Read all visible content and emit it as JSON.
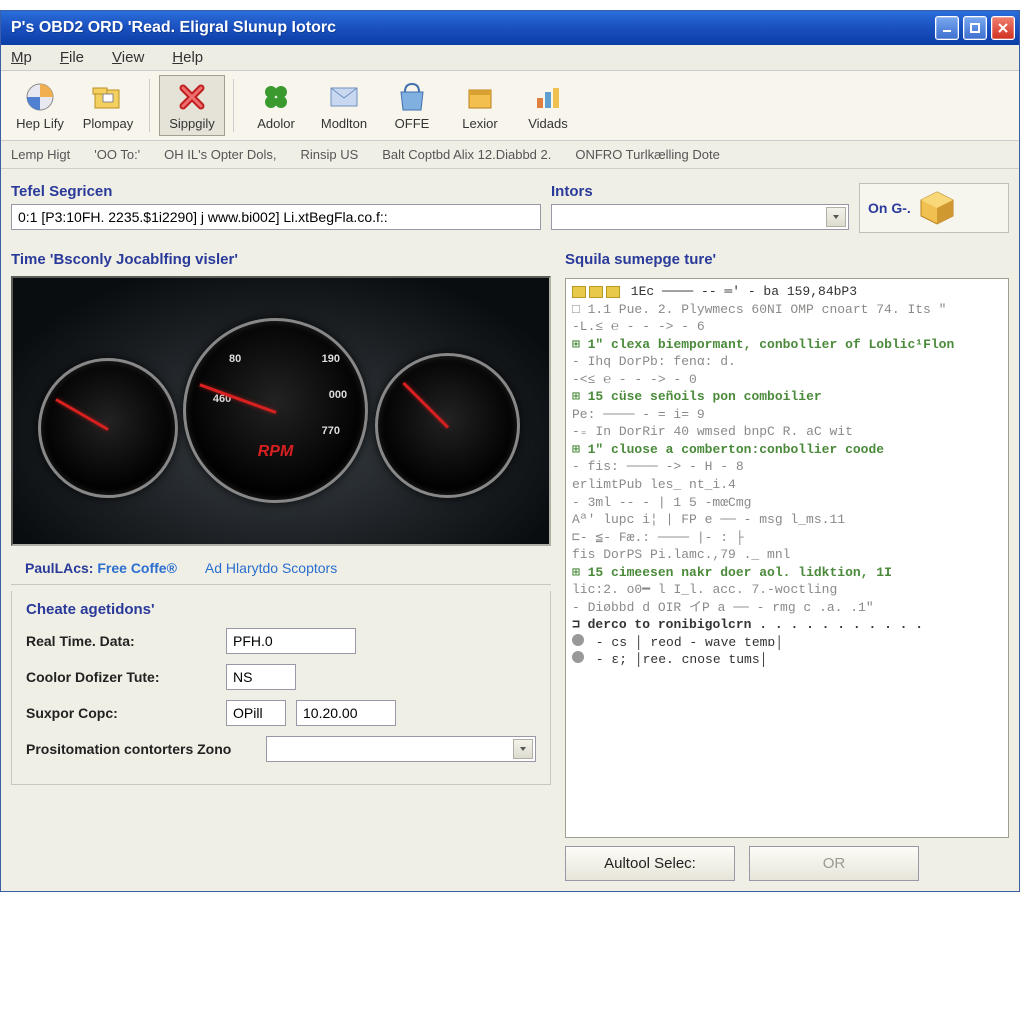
{
  "window": {
    "title": "P's OBD2 ORD 'Read. Eligral Slunup Iotorc"
  },
  "menu": [
    "Mp",
    "File",
    "View",
    "Help"
  ],
  "toolbar": [
    {
      "label": "Hep Lify"
    },
    {
      "label": "Plompay"
    },
    {
      "label": "Sippgily"
    },
    {
      "label": "Adolor"
    },
    {
      "label": "Modlton"
    },
    {
      "label": "OFFE"
    },
    {
      "label": "Lexior"
    },
    {
      "label": "Vidads"
    }
  ],
  "statusstrip": [
    "Lemp Higt",
    "'OO To:'",
    "OH IL's Opter Dols,",
    "Rinsip US",
    "Balt Coptbd Alix 12.Diabbd 2.",
    "ONFRO Turlkælling Dote"
  ],
  "search": {
    "left_label": "Tefel Segricen",
    "left_value": "0:1 [P3:10FH. 2235.$1i2290] j www.bi002] Li.xtBegFla.co.f::",
    "mid_label": "Intors",
    "mid_value": "",
    "corner_label": "On G-."
  },
  "left_panel": {
    "title": "Time 'Bsconly Jocablfing visler'",
    "tabs": {
      "a": "PaulLAcs:",
      "b": "Free Coffe®",
      "c": "Ad Hlarytdo Scoptors"
    },
    "form_title": "Cheate agetidons'",
    "fields": {
      "f1_label": "Real Time. Data:",
      "f1_value": "PFH.0",
      "f2_label": "Coolor Dofizer Tute:",
      "f2_value": "NS",
      "f3_label": "Suxpor Copc:",
      "f3a": "OPill",
      "f3b": "10.20.00",
      "f4_label": "Prositomation contorters Zono",
      "f4_value": ""
    },
    "gauge_numbers": {
      "a": "460",
      "b": "190",
      "c": "000",
      "d": "770",
      "e": "80",
      "rpm": "RPM"
    }
  },
  "right_panel": {
    "title": "Squila sumepge ture'",
    "code_lines": [
      "□ ▣ ▣ ▣  1Ec ──── -- ═' -  ba   159,84bP3",
      "□ 1.1   Pue. 2. Plywmecs 60NI OMP cnoart 74. Its \"",
      "-L.≤ ℮ - - ->  -  6",
      "⊞ 1\" clexa biempormant, conbollier of Loblic¹Flon",
      "   -       Ihq DorPb:   fenα:  d.",
      "-<≤ ℮ - - ->  -  0",
      "⊞ 15 cüse señoils pon comboilier",
      "   Pe: ──── - = i=    9",
      "-₌  In DorRir 40 wmsed bnpC R. aC wit",
      "⊞ 1\" cluose a comberton:conbollier coode",
      "   -   fis: ──── -> - H -  8",
      "   erlimtPub   les_ nt_i.4",
      "-  3ml -- -   |   1   5 -mœCmg",
      "   Aª' lupc i¦   | FP e ── -   msg l_ms.11",
      "⊏- ≦-   Fæ.: ──── |-  :  ├ ",
      "   fis DorPS  Pi.lamc.,79 ._ mnl",
      "⊞ 15 cimeesen nakr doer aol. lidktion, 1I",
      "  lic:2. o0━ l   I_l. acc. 7.-woctling",
      "-  Diøbbd d OIR  イP  a ── -   rmg c .a. .1\"",
      "",
      "⊐ derco to ronibigolcrn  . . . . . . . . . . . ",
      "  ●  - cs │ reod  - wave temɒ│",
      "  ●  - ε; │ree. cnose tums│"
    ],
    "btn1": "Aultool Selec:",
    "btn2": "OR"
  }
}
